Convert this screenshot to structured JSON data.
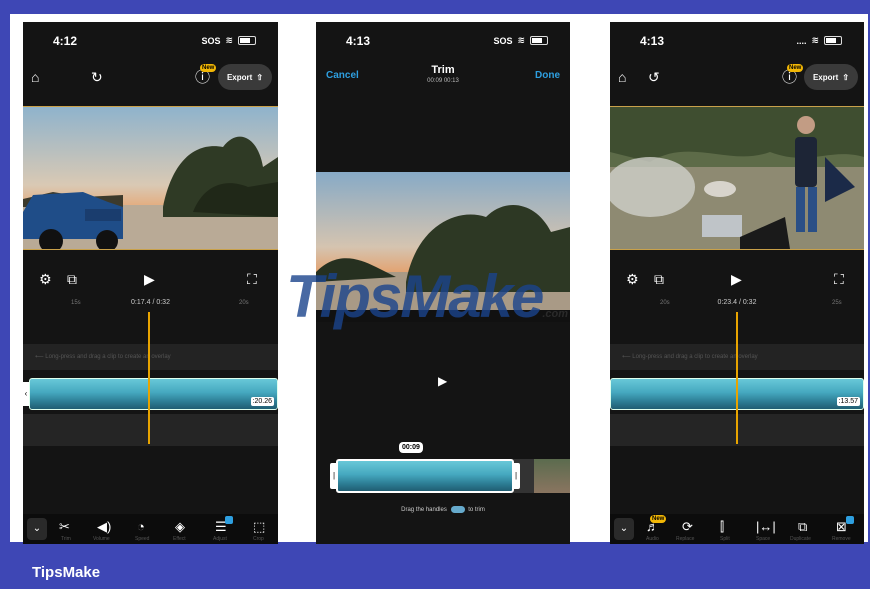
{
  "brand": {
    "footer": "TipsMake",
    "watermark": "TipsMake",
    "watermark_suffix": ".com"
  },
  "colors": {
    "background": "#3e47b5",
    "accent_blue": "#2e9fe0",
    "playhead": "#e8a400",
    "new_badge": "#f2b705"
  },
  "screens": [
    {
      "status": {
        "time": "4:12",
        "signal": "SOS"
      },
      "header": {
        "new_badge": "New",
        "export_label": "Export"
      },
      "player": {
        "timestamp": "0:17.4 / 0:32"
      },
      "timeline": {
        "ruler_marks": [
          "15s",
          "20s"
        ],
        "hint": "⟵ Long-press and drag a clip to create an overlay",
        "clip_duration": ":20.26"
      },
      "toolbar": {
        "labels": [
          "Trim",
          "Volume",
          "Speed",
          "Effect",
          "Adjust",
          "Crop"
        ]
      }
    },
    {
      "status": {
        "time": "4:13",
        "signal": "SOS"
      },
      "header": {
        "cancel_label": "Cancel",
        "title": "Trim",
        "subtitle": "00:09 00:13",
        "done_label": "Done"
      },
      "trim": {
        "selection_time": "00:09",
        "hint_before": "Drag the handles",
        "hint_after": "to trim"
      }
    },
    {
      "status": {
        "time": "4:13",
        "signal": "...."
      },
      "header": {
        "new_badge": "New",
        "export_label": "Export"
      },
      "player": {
        "timestamp": "0:23.4 / 0:32"
      },
      "timeline": {
        "ruler_marks": [
          "20s",
          "25s"
        ],
        "hint": "⟵ Long-press and drag a clip to create an overlay",
        "clip_duration": ":13.57"
      },
      "toolbar": {
        "new_badge": "New",
        "labels": [
          "Audio",
          "Replace",
          "Split",
          "Space",
          "Duplicate",
          "Remove"
        ]
      }
    }
  ]
}
